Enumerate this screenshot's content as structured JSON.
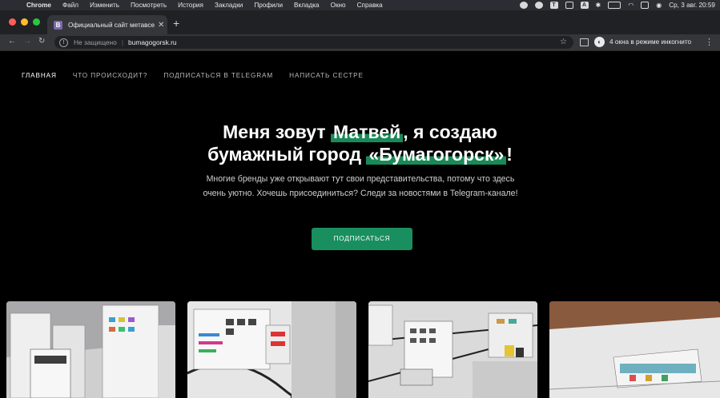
{
  "menubar": {
    "app": "Chrome",
    "items": [
      "Файл",
      "Изменить",
      "Посмотреть",
      "История",
      "Закладки",
      "Профили",
      "Вкладка",
      "Окно",
      "Справка"
    ],
    "datetime": "Ср, 3 авг. 20:59"
  },
  "tab": {
    "favicon_letter": "B",
    "title": "Официальный сайт метавселенной"
  },
  "toolbar": {
    "security": "Не защищено",
    "url": "bumagogorsk.ru",
    "incognito": "4 окна в режиме инкогнито"
  },
  "site_nav": [
    "ГЛАВНАЯ",
    "ЧТО ПРОИСХОДИТ?",
    "ПОДПИСАТЬСЯ В TELEGRAM",
    "НАПИСАТЬ СЕСТРЕ"
  ],
  "hero": {
    "title_part1": "Меня зовут ",
    "name": "Матвей",
    "title_part2": ", я создаю",
    "title_part3": "бумажный город ",
    "city": "«Бумагогорск»",
    "title_part4": "!",
    "subtitle": "Многие бренды уже открывают тут свои представительства, потому что здесь очень уютно. Хочешь присоединиться? Следи за новостями в Telegram-канале!",
    "button": "ПОДПИСАТЬСЯ"
  },
  "colors": {
    "accent": "#198f5f",
    "highlight": "#1a8a58",
    "background": "#000000"
  }
}
